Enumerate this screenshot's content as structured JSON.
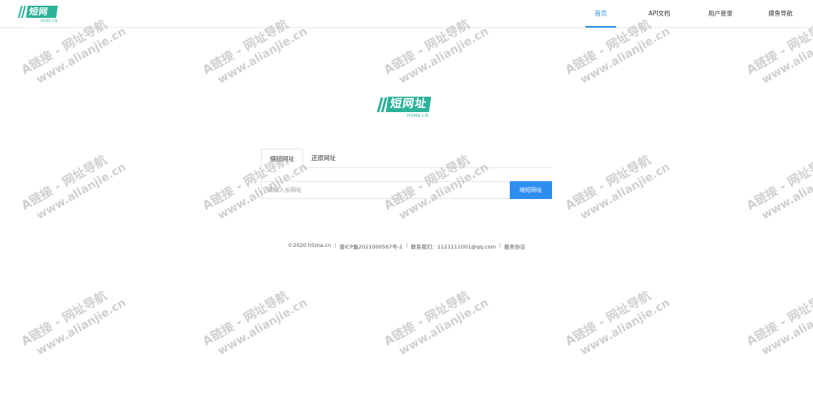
{
  "header": {
    "logo_text": "短网址",
    "logo_sub": "H5MA.CN",
    "nav": [
      {
        "label": "首页",
        "active": true
      },
      {
        "label": "API文档",
        "active": false
      },
      {
        "label": "用户登录",
        "active": false
      },
      {
        "label": "摸鱼导航",
        "active": false
      }
    ]
  },
  "main": {
    "logo_text": "短网址",
    "logo_sub": "H5MA.CN",
    "tabs": [
      {
        "label": "缩短网址",
        "active": true
      },
      {
        "label": "还原网址",
        "active": false
      }
    ],
    "input_placeholder": "请输入长网址",
    "input_value": "",
    "submit_label": "缩短网址"
  },
  "footer": {
    "copyright": "©2020 h5ma.cn",
    "icp": "晋ICP备2021000567号-2",
    "contact": "联系我们：1121111001@qq.com",
    "terms": "服务协议"
  },
  "watermark": {
    "line1": "A链接 - 网址导航",
    "line2": "www.alianjie.cn"
  },
  "colors": {
    "brand_green": "#2bb39a",
    "accent_blue": "#2b8fe8",
    "button_blue": "#2d8ef0"
  }
}
